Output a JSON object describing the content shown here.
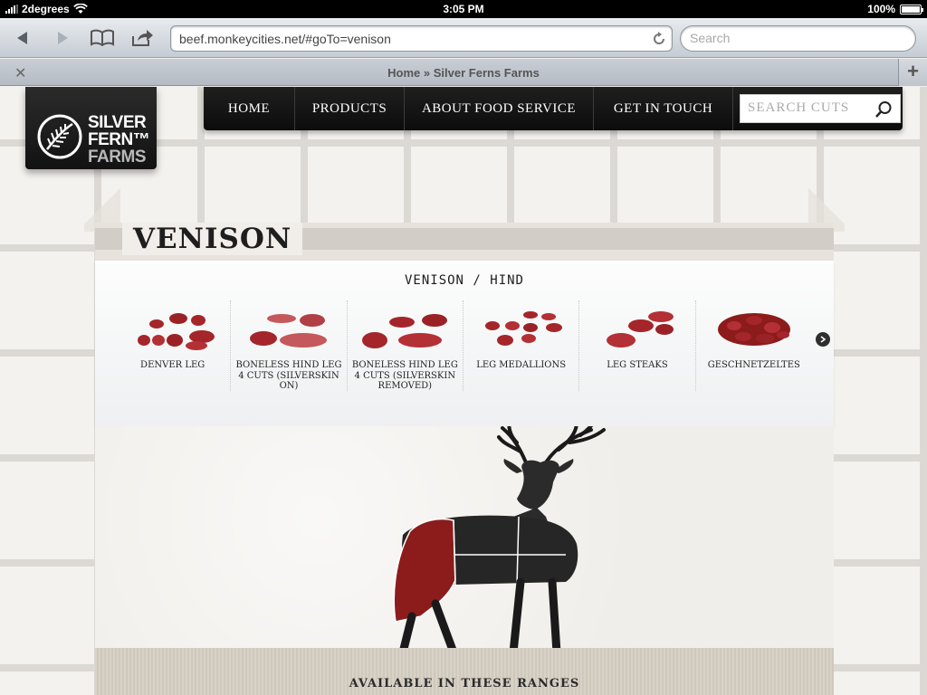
{
  "statusbar": {
    "carrier": "2degrees",
    "time": "3:05 PM",
    "battery": "100%"
  },
  "browser": {
    "url": "beef.monkeycities.net/#goTo=venison",
    "search_placeholder": "Search",
    "tab_title": "Home » Silver Ferns Farms"
  },
  "logo": {
    "line1": "SILVER",
    "line2": "FERN™",
    "line3": "FARMS"
  },
  "nav": {
    "items": [
      {
        "label": "HOME"
      },
      {
        "label": "PRODUCTS"
      },
      {
        "label": "ABOUT FOOD SERVICE"
      },
      {
        "label": "GET IN TOUCH"
      }
    ],
    "search_placeholder": "SEARCH CUTS"
  },
  "page": {
    "title": "VENISON",
    "cuts_heading": "VENISON / HIND",
    "cuts": [
      {
        "label": "DENVER LEG"
      },
      {
        "label": "BONELESS HIND LEG 4 CUTS (SILVERSKIN ON)"
      },
      {
        "label": "BONELESS HIND LEG 4 CUTS (SILVERSKIN REMOVED)"
      },
      {
        "label": "LEG MEDALLIONS"
      },
      {
        "label": "LEG STEAKS"
      },
      {
        "label": "GESCHNETZELTES"
      }
    ],
    "ranges_title": "AVAILABLE IN THESE RANGES"
  },
  "colors": {
    "meat": "#a4262a",
    "highlight": "#8c1c1c",
    "nav_bg": "#141414"
  }
}
